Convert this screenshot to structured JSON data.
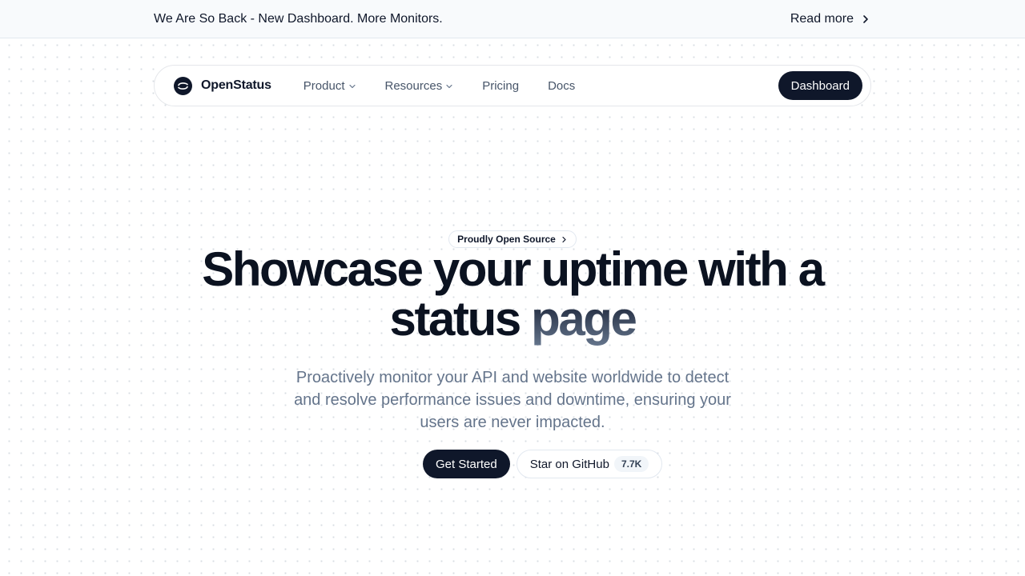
{
  "banner": {
    "text": "We Are So Back - New Dashboard. More Monitors.",
    "link_label": "Read more",
    "link_icon": "chevron-right-icon"
  },
  "nav": {
    "logo_text": "OpenStatus",
    "items": [
      {
        "label": "Product",
        "has_dropdown": true
      },
      {
        "label": "Resources",
        "has_dropdown": true
      },
      {
        "label": "Pricing",
        "has_dropdown": false
      },
      {
        "label": "Docs",
        "has_dropdown": false
      }
    ],
    "dashboard_label": "Dashboard"
  },
  "hero": {
    "badge_label": "Proudly Open Source",
    "headline_line1": "Showcase your uptime with a",
    "headline_line2_a": "status",
    "headline_line2_b": "page",
    "subtitle": "Proactively monitor your API and website worldwide to detect and resolve performance issues and downtime, ensuring your users are never impacted.",
    "primary_cta": "Get Started",
    "secondary_cta": "Star on GitHub",
    "github_stars": "7.7K"
  },
  "colors": {
    "primary": "#0f172a",
    "muted_text": "#64748b",
    "border": "#e2e8f0",
    "banner_bg": "#f8fafc"
  }
}
